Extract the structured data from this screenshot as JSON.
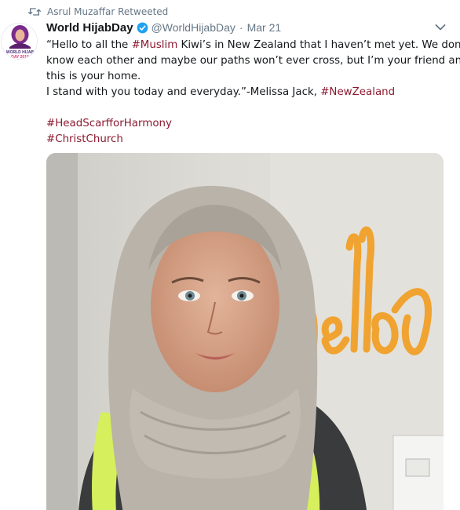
{
  "retweet": {
    "label": "Asrul Muzaffar Retweeted"
  },
  "tweet": {
    "display_name": "World HijabDay",
    "handle": "@WorldHijabDay",
    "separator": "·",
    "date": "Mar 21",
    "lines": [
      {
        "pre": "“Hello to all the ",
        "tag": "#Muslim",
        "post": " Kiwi’s in New Zealand that I haven’t met yet. We don’t"
      },
      {
        "text": "know each other and maybe our paths won’t ever cross, but I’m your friend and"
      },
      {
        "text": "this is your home."
      },
      {
        "pre": "I stand with you today and everyday.”-Melissa Jack, ",
        "tag": "#NewZealand"
      }
    ],
    "hashtags": [
      "#HeadScarfforHarmony",
      "#ChristChurch"
    ]
  },
  "avatar": {
    "badge_line1": "WORLD HIJAB",
    "badge_line2": "DAY 2019"
  },
  "photo": {
    "wall_sign": "hello"
  },
  "colors": {
    "hashtag": "#8a1a2f",
    "muted": "#657786",
    "verified": "#1da1f2",
    "neon_sign": "#f0a330"
  }
}
